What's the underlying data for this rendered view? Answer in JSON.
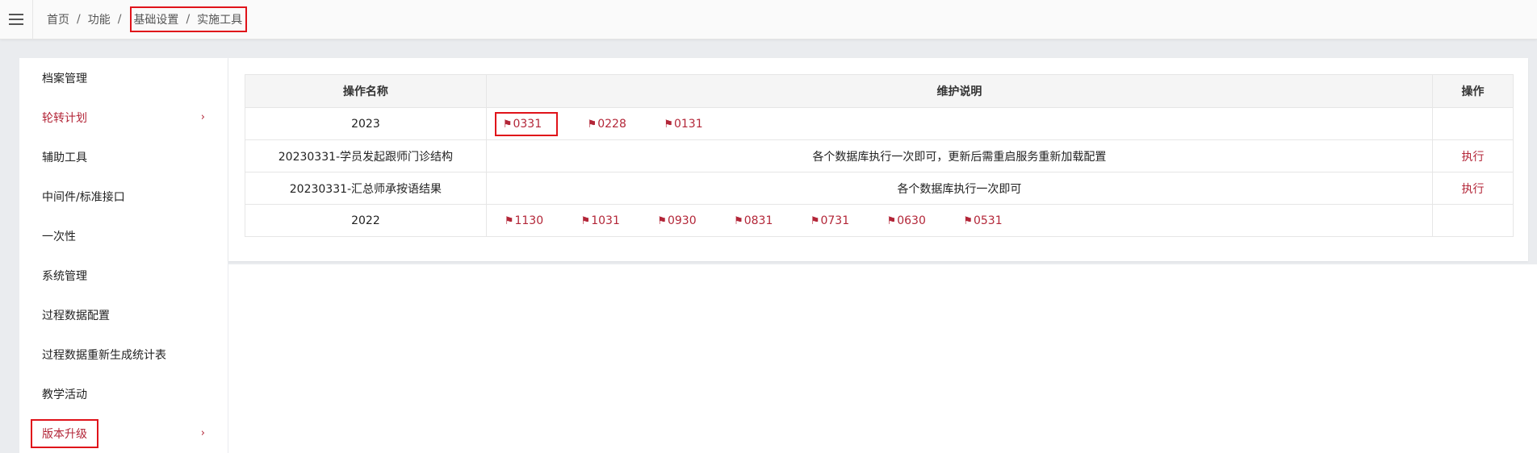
{
  "breadcrumb": {
    "home": "首页",
    "functions": "功能",
    "basic_settings": "基础设置",
    "current": "实施工具",
    "separator": "/"
  },
  "sidebar": {
    "items": [
      {
        "label": "档案管理",
        "has_chevron": false,
        "active": false
      },
      {
        "label": "轮转计划",
        "has_chevron": true,
        "active": true
      },
      {
        "label": "辅助工具",
        "has_chevron": false,
        "active": false
      },
      {
        "label": "中间件/标准接口",
        "has_chevron": false,
        "active": false
      },
      {
        "label": "一次性",
        "has_chevron": false,
        "active": false
      },
      {
        "label": "系统管理",
        "has_chevron": false,
        "active": false
      },
      {
        "label": "过程数据配置",
        "has_chevron": false,
        "active": false
      },
      {
        "label": "过程数据重新生成统计表",
        "has_chevron": false,
        "active": false
      },
      {
        "label": "教学活动",
        "has_chevron": false,
        "active": false
      },
      {
        "label": "版本升级",
        "has_chevron": true,
        "active": true
      }
    ],
    "chevron": "›"
  },
  "table": {
    "headers": [
      "操作名称",
      "维护说明",
      "操作"
    ],
    "rows": [
      {
        "name": "2023",
        "links": [
          "0331",
          "0228",
          "0131"
        ]
      },
      {
        "name": "20230331-学员发起跟师门诊结构",
        "desc": "各个数据库执行一次即可，更新后需重启服务重新加载配置",
        "action": "执行"
      },
      {
        "name": "20230331-汇总师承按语结果",
        "desc": "各个数据库执行一次即可",
        "action": "执行"
      },
      {
        "name": "2022",
        "links": [
          "1130",
          "1031",
          "0930",
          "0831",
          "0731",
          "0630",
          "0531"
        ]
      }
    ]
  },
  "icons": {
    "flag": "flag-icon",
    "menu": "hamburger-icon"
  },
  "colors": {
    "accent": "#b32638",
    "highlight_box": "#e0131a"
  }
}
